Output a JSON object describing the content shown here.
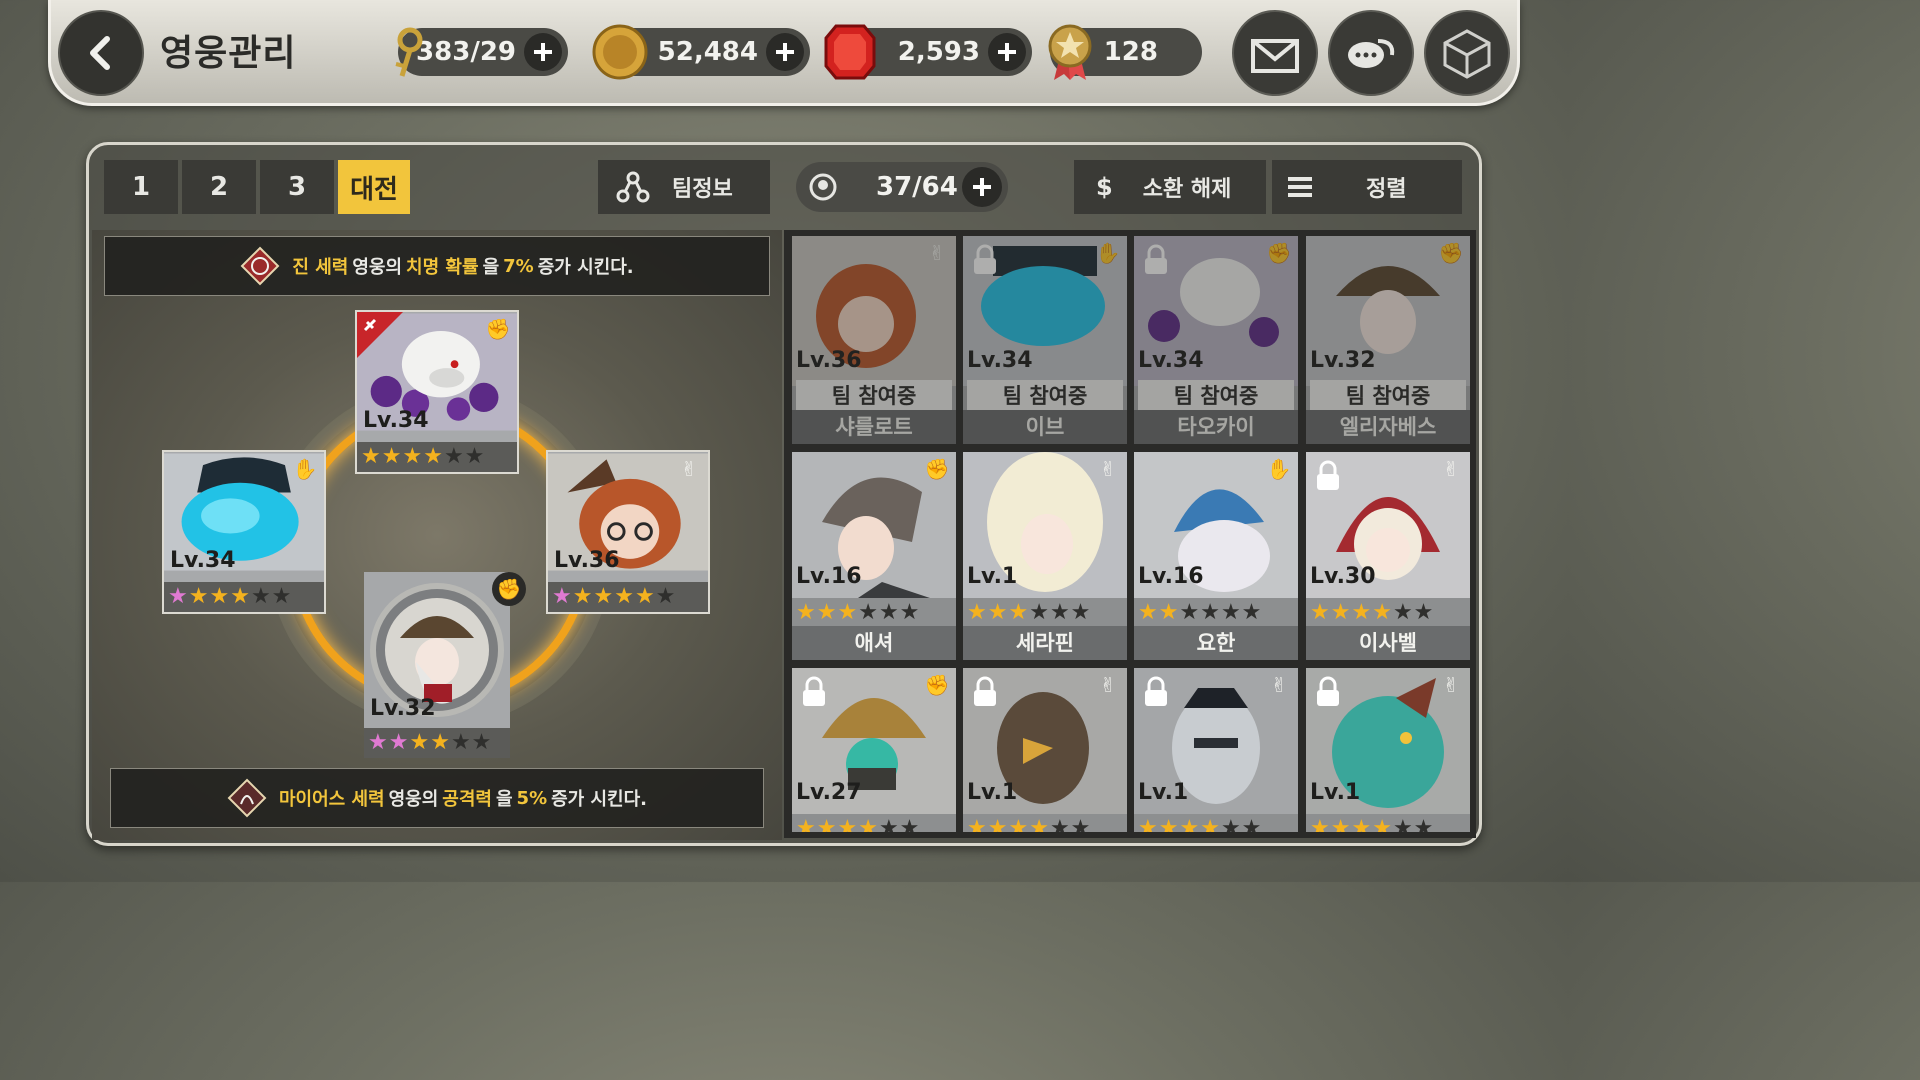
{
  "header": {
    "title": "영웅관리",
    "resources": [
      {
        "icon": "key-icon",
        "value": "383/29"
      },
      {
        "icon": "gold-coin-icon",
        "value": "52,484"
      },
      {
        "icon": "ruby-icon",
        "value": "2,593"
      },
      {
        "icon": "medal-icon",
        "value": "128"
      }
    ],
    "buttons": [
      "mail-icon",
      "chat-icon",
      "dice-icon"
    ]
  },
  "tabs": [
    {
      "label": "1",
      "active": false
    },
    {
      "label": "2",
      "active": false
    },
    {
      "label": "3",
      "active": false
    },
    {
      "label": "대전",
      "active": true
    }
  ],
  "toolbar": {
    "team_info": "팀정보",
    "slots": "37/64",
    "release": "소환 해제",
    "release_symbol": "$",
    "sort": "정렬"
  },
  "bonuses": {
    "top": {
      "prefix": "진 세력",
      "t1": " 영웅의 ",
      "stat": "치명 확률",
      "t2": "을 ",
      "amount": "7%",
      "t3": "증가 시킨다."
    },
    "bottom": {
      "prefix": "마이어스 세력",
      "t1": " 영웅의 ",
      "stat": "공격력",
      "t2": "을 ",
      "amount": "5%",
      "t3": "증가 시킨다."
    }
  },
  "formation": [
    {
      "pos": "top",
      "level": "Lv.34",
      "stars": [
        1,
        1,
        1,
        1,
        0,
        0
      ],
      "pink": 0,
      "class": "fist-icon"
    },
    {
      "pos": "left",
      "level": "Lv.34",
      "stars": [
        1,
        1,
        1,
        1,
        0,
        0
      ],
      "pink": 1,
      "class": "hand-icon"
    },
    {
      "pos": "right",
      "level": "Lv.36",
      "stars": [
        1,
        1,
        1,
        1,
        1,
        0
      ],
      "pink": 1,
      "class": "peace-icon"
    },
    {
      "pos": "bottom",
      "level": "Lv.32",
      "stars": [
        1,
        1,
        1,
        1,
        0,
        0
      ],
      "pink": 2,
      "class": "fist-icon"
    }
  ],
  "roster": [
    {
      "level": "Lv.36",
      "name": "샤를로트",
      "team": "팀 참여중",
      "locked": false,
      "class": "peace-icon"
    },
    {
      "level": "Lv.34",
      "name": "이브",
      "team": "팀 참여중",
      "locked": true,
      "class": "hand-icon"
    },
    {
      "level": "Lv.34",
      "name": "타오카이",
      "team": "팀 참여중",
      "locked": true,
      "class": "fist-icon"
    },
    {
      "level": "Lv.32",
      "name": "엘리자베스",
      "team": "팀 참여중",
      "locked": false,
      "class": "fist-icon"
    },
    {
      "level": "Lv.16",
      "name": "애셔",
      "stars": 3,
      "locked": false,
      "class": "fist-icon"
    },
    {
      "level": "Lv.1",
      "name": "세라핀",
      "stars": 3,
      "locked": false,
      "class": "peace-icon"
    },
    {
      "level": "Lv.16",
      "name": "요한",
      "stars": 2,
      "locked": false,
      "class": "hand-icon"
    },
    {
      "level": "Lv.30",
      "name": "이사벨",
      "stars": 4,
      "locked": true,
      "class": "peace-icon"
    },
    {
      "level": "Lv.27",
      "name": "",
      "stars": 4,
      "locked": true,
      "class": "fist-icon"
    },
    {
      "level": "Lv.1",
      "name": "",
      "stars": 4,
      "locked": true,
      "class": "peace-icon"
    },
    {
      "level": "Lv.1",
      "name": "",
      "stars": 4,
      "locked": true,
      "class": "peace-icon"
    },
    {
      "level": "Lv.1",
      "name": "",
      "stars": 4,
      "locked": true,
      "class": "peace-icon"
    }
  ],
  "colors": {
    "accent": "#f2c53c",
    "ring": "#f0a21c",
    "star": "#f4b21e",
    "pink_star": "#e07ad2"
  }
}
